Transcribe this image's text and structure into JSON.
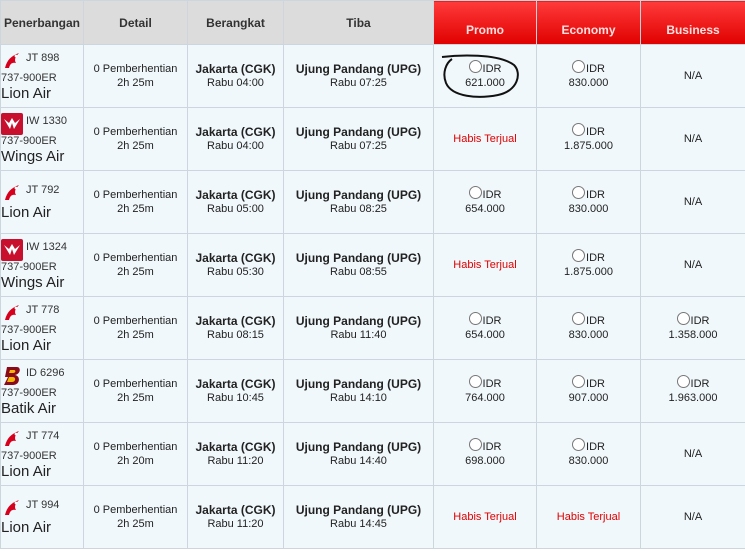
{
  "columns": {
    "airline": "Penerbangan",
    "detail": "Detail",
    "depart": "Berangkat",
    "arrive": "Tiba",
    "promo": "Promo",
    "economy": "Economy",
    "business": "Business"
  },
  "colors": {
    "header_gray": "#dcdcdc",
    "header_red": "#e00000",
    "row_bg": "#f0f8fb",
    "sold_out": "#e00000"
  },
  "flights": [
    {
      "code": "JT 898",
      "model": "737-900ER",
      "airline": "Lion Air",
      "logo": "lion-air-logo",
      "stops": "0 Pemberhentian",
      "duration": "2h 25m",
      "dep_city": "Jakarta (CGK)",
      "dep_time": "Rabu 04:00",
      "arr_city": "Ujung Pandang (UPG)",
      "arr_time": "Rabu 07:25",
      "promo": {
        "cur": "IDR",
        "amt": "621.000"
      },
      "economy": {
        "cur": "IDR",
        "amt": "830.000"
      },
      "business": {
        "text": "N/A"
      }
    },
    {
      "code": "IW 1330",
      "model": "737-900ER",
      "airline": "Wings Air",
      "logo": "wings-air-logo",
      "stops": "0 Pemberhentian",
      "duration": "2h 25m",
      "dep_city": "Jakarta (CGK)",
      "dep_time": "Rabu 04:00",
      "arr_city": "Ujung Pandang (UPG)",
      "arr_time": "Rabu 07:25",
      "promo": {
        "text": "Habis Terjual"
      },
      "economy": {
        "cur": "IDR",
        "amt": "1.875.000"
      },
      "business": {
        "text": "N/A"
      }
    },
    {
      "code": "JT 792",
      "model": "",
      "airline": "Lion Air",
      "logo": "lion-air-logo",
      "stops": "0 Pemberhentian",
      "duration": "2h 25m",
      "dep_city": "Jakarta (CGK)",
      "dep_time": "Rabu 05:00",
      "arr_city": "Ujung Pandang (UPG)",
      "arr_time": "Rabu 08:25",
      "promo": {
        "cur": "IDR",
        "amt": "654.000"
      },
      "economy": {
        "cur": "IDR",
        "amt": "830.000"
      },
      "business": {
        "text": "N/A"
      }
    },
    {
      "code": "IW 1324",
      "model": "737-900ER",
      "airline": "Wings Air",
      "logo": "wings-air-logo",
      "stops": "0 Pemberhentian",
      "duration": "2h 25m",
      "dep_city": "Jakarta (CGK)",
      "dep_time": "Rabu 05:30",
      "arr_city": "Ujung Pandang (UPG)",
      "arr_time": "Rabu 08:55",
      "promo": {
        "text": "Habis Terjual"
      },
      "economy": {
        "cur": "IDR",
        "amt": "1.875.000"
      },
      "business": {
        "text": "N/A"
      }
    },
    {
      "code": "JT 778",
      "model": "737-900ER",
      "airline": "Lion Air",
      "logo": "lion-air-logo",
      "stops": "0 Pemberhentian",
      "duration": "2h 25m",
      "dep_city": "Jakarta (CGK)",
      "dep_time": "Rabu 08:15",
      "arr_city": "Ujung Pandang (UPG)",
      "arr_time": "Rabu 11:40",
      "promo": {
        "cur": "IDR",
        "amt": "654.000"
      },
      "economy": {
        "cur": "IDR",
        "amt": "830.000"
      },
      "business": {
        "cur": "IDR",
        "amt": "1.358.000"
      }
    },
    {
      "code": "ID 6296",
      "model": "737-900ER",
      "airline": "Batik Air",
      "logo": "batik-air-logo",
      "stops": "0 Pemberhentian",
      "duration": "2h 25m",
      "dep_city": "Jakarta (CGK)",
      "dep_time": "Rabu 10:45",
      "arr_city": "Ujung Pandang (UPG)",
      "arr_time": "Rabu 14:10",
      "promo": {
        "cur": "IDR",
        "amt": "764.000"
      },
      "economy": {
        "cur": "IDR",
        "amt": "907.000"
      },
      "business": {
        "cur": "IDR",
        "amt": "1.963.000"
      }
    },
    {
      "code": "JT 774",
      "model": "737-900ER",
      "airline": "Lion Air",
      "logo": "lion-air-logo",
      "stops": "0 Pemberhentian",
      "duration": "2h 20m",
      "dep_city": "Jakarta (CGK)",
      "dep_time": "Rabu 11:20",
      "arr_city": "Ujung Pandang (UPG)",
      "arr_time": "Rabu 14:40",
      "promo": {
        "cur": "IDR",
        "amt": "698.000"
      },
      "economy": {
        "cur": "IDR",
        "amt": "830.000"
      },
      "business": {
        "text": "N/A"
      }
    },
    {
      "code": "JT 994",
      "model": "",
      "airline": "Lion Air",
      "logo": "lion-air-logo",
      "stops": "0 Pemberhentian",
      "duration": "2h 25m",
      "dep_city": "Jakarta (CGK)",
      "dep_time": "Rabu 11:20",
      "arr_city": "Ujung Pandang (UPG)",
      "arr_time": "Rabu 14:45",
      "promo": {
        "text": "Habis Terjual"
      },
      "economy": {
        "text": "Habis Terjual"
      },
      "business": {
        "text": "N/A"
      }
    }
  ]
}
